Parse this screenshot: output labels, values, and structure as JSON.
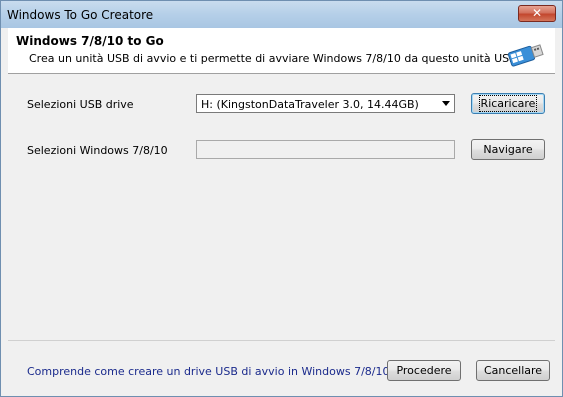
{
  "window": {
    "title": "Windows To Go Creatore",
    "close_label": "✕"
  },
  "header": {
    "title": "Windows 7/8/10 to Go",
    "description": "Crea un unità USB di avvio e ti permette di avviare Windows 7/8/10 da questo unità USB.",
    "icon": "usb-drive-icon"
  },
  "form": {
    "usb_label": "Selezioni USB drive",
    "usb_selected": "H: (KingstonDataTraveler 3.0, 14.44GB)",
    "reload_label": "Ricaricare",
    "windows_label": "Selezioni Windows 7/8/10",
    "windows_value": "",
    "browse_label": "Navigare"
  },
  "footer": {
    "help_link": "Comprende come creare un drive USB di avvio in Windows 7/8/10??",
    "proceed_label": "Procedere",
    "cancel_label": "Cancellare"
  },
  "colors": {
    "link": "#1a2a8c",
    "titlebar": "#b5cfe8",
    "close": "#c3472e"
  }
}
